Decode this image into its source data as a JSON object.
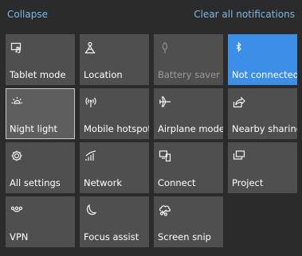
{
  "header": {
    "collapse_label": "Collapse",
    "clear_label": "Clear all notifications"
  },
  "tiles": [
    {
      "label": "Tablet mode",
      "icon": "tablet-mode-icon",
      "state": "off"
    },
    {
      "label": "Location",
      "icon": "location-icon",
      "state": "off"
    },
    {
      "label": "Battery saver",
      "icon": "battery-saver-icon",
      "state": "disabled"
    },
    {
      "label": "Not connected",
      "icon": "bluetooth-icon",
      "state": "on"
    },
    {
      "label": "Night light",
      "icon": "night-light-icon",
      "state": "focused"
    },
    {
      "label": "Mobile hotspot",
      "icon": "mobile-hotspot-icon",
      "state": "off"
    },
    {
      "label": "Airplane mode",
      "icon": "airplane-icon",
      "state": "off"
    },
    {
      "label": "Nearby sharing",
      "icon": "nearby-sharing-icon",
      "state": "off"
    },
    {
      "label": "All settings",
      "icon": "gear-icon",
      "state": "off"
    },
    {
      "label": "Network",
      "icon": "network-icon",
      "state": "off"
    },
    {
      "label": "Connect",
      "icon": "connect-icon",
      "state": "off"
    },
    {
      "label": "Project",
      "icon": "project-icon",
      "state": "off"
    },
    {
      "label": "VPN",
      "icon": "vpn-icon",
      "state": "off"
    },
    {
      "label": "Focus assist",
      "icon": "moon-icon",
      "state": "off"
    },
    {
      "label": "Screen snip",
      "icon": "screen-snip-icon",
      "state": "off"
    }
  ],
  "colors": {
    "background": "#2b2b2b",
    "tile": "#4f4f4f",
    "tile_active": "#3d8ee6",
    "link": "#7cb7ea"
  }
}
